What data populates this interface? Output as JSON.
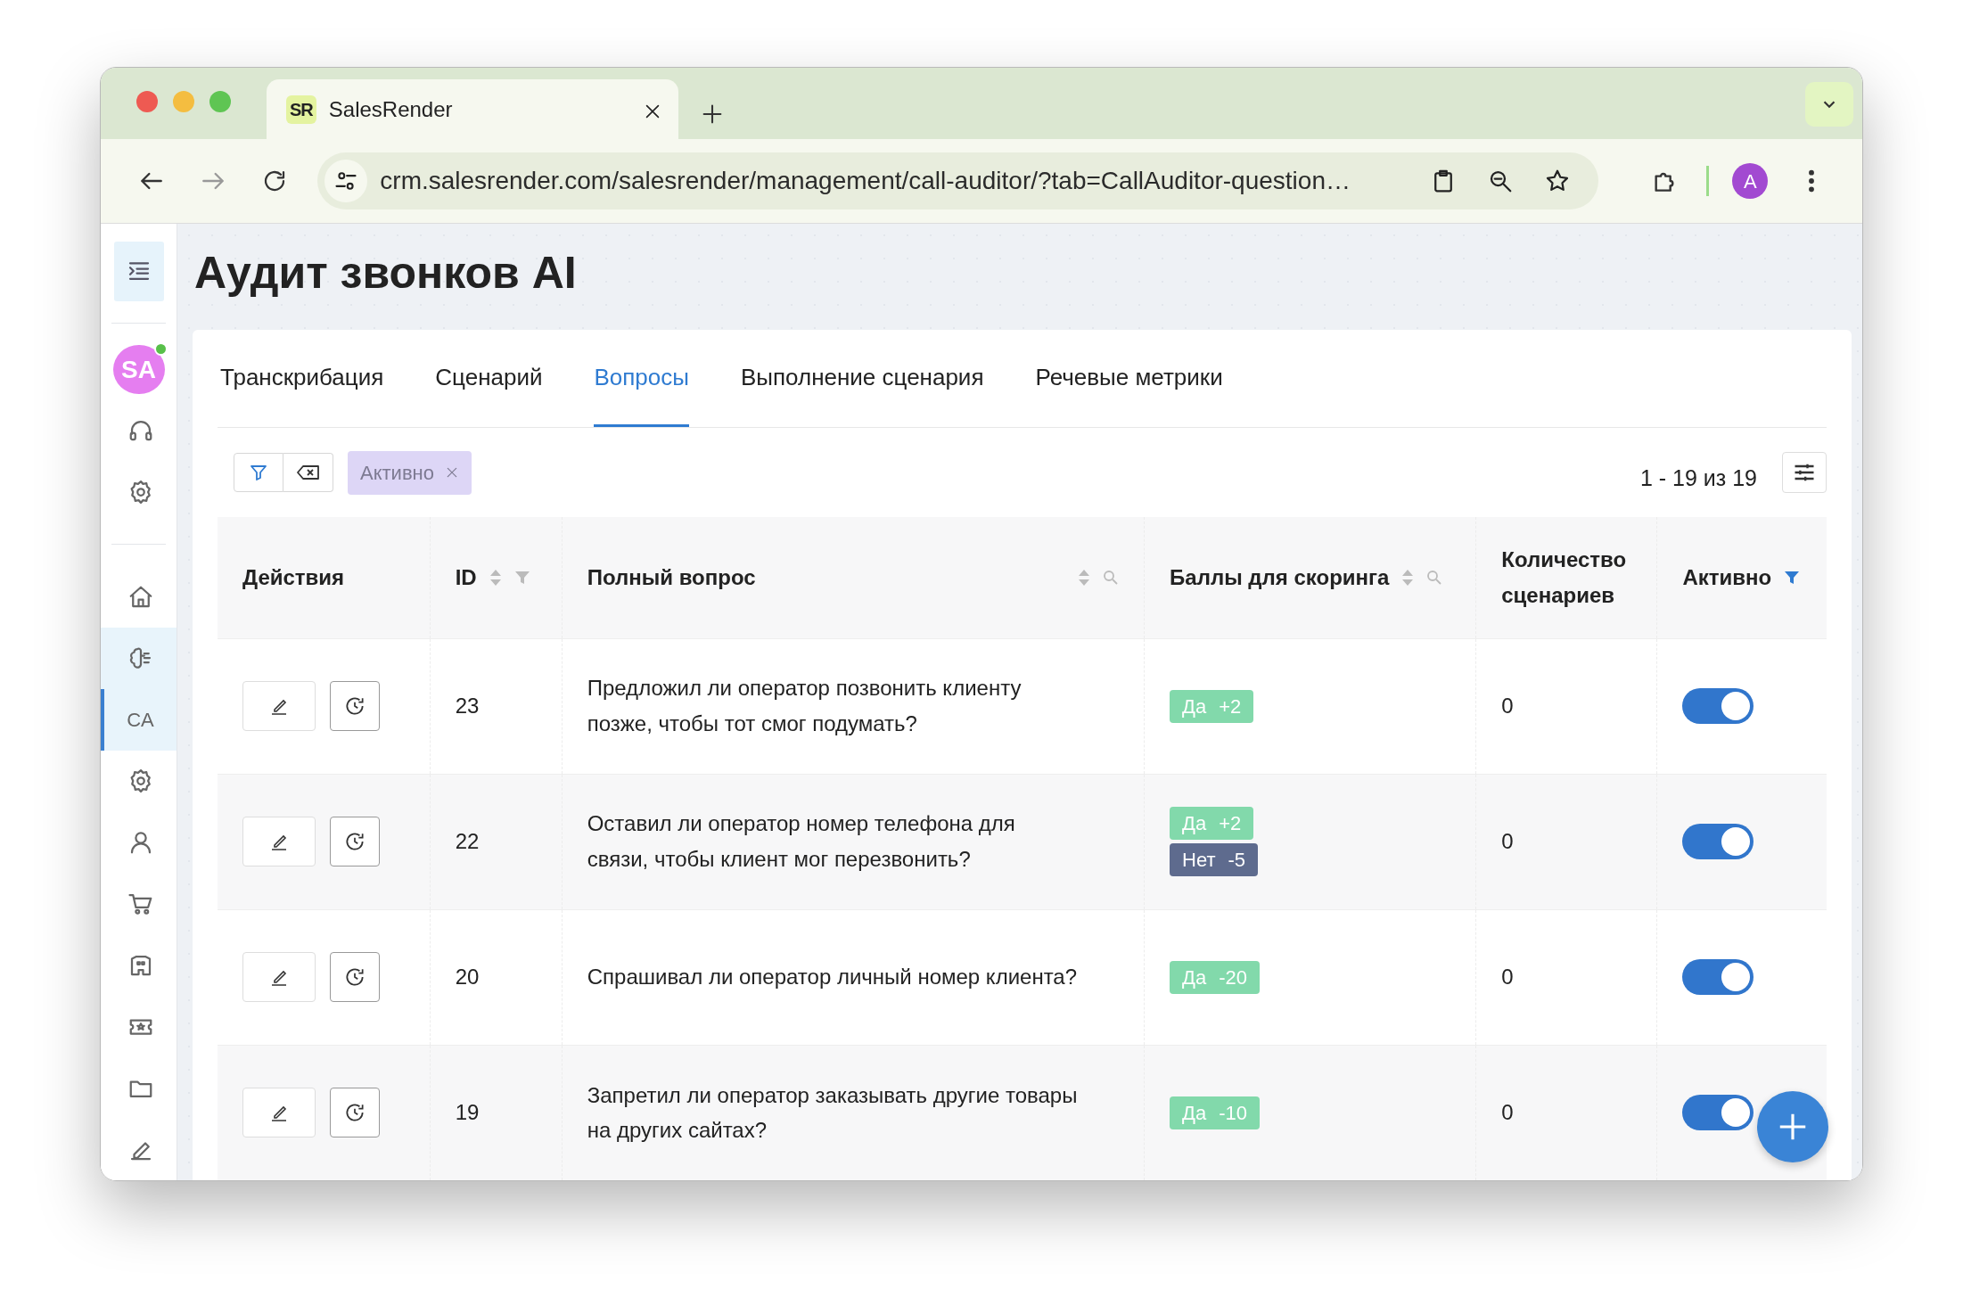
{
  "browser": {
    "tab_title": "SalesRender",
    "favicon": "SR",
    "url": "crm.salesrender.com/salesrender/management/call-auditor/?tab=CallAuditor-question…",
    "profile": "A"
  },
  "sidebar": {
    "avatar": "SA",
    "online": true,
    "top_items": [
      {
        "kind": "icon",
        "selected": false,
        "highlighted": false
      },
      {
        "kind": "icon",
        "selected": false,
        "highlighted": false
      }
    ],
    "items": [
      {
        "kind": "icon",
        "selected": false,
        "highlighted": false
      },
      {
        "kind": "icon",
        "selected": false,
        "highlighted": true
      },
      {
        "kind": "text",
        "label": "CA",
        "selected": true,
        "highlighted": true
      },
      {
        "kind": "icon",
        "selected": false,
        "highlighted": false
      },
      {
        "kind": "icon",
        "selected": false,
        "highlighted": false
      },
      {
        "kind": "icon",
        "selected": false,
        "highlighted": false
      },
      {
        "kind": "icon",
        "selected": false,
        "highlighted": false
      },
      {
        "kind": "icon",
        "selected": false,
        "highlighted": false
      },
      {
        "kind": "icon",
        "selected": false,
        "highlighted": false
      },
      {
        "kind": "icon",
        "selected": false,
        "highlighted": false
      }
    ]
  },
  "page_title": "Аудит звонков AI",
  "tabs": [
    {
      "label": "Транскрибация",
      "selected": false
    },
    {
      "label": "Сценарий",
      "selected": false
    },
    {
      "label": "Вопросы",
      "selected": true
    },
    {
      "label": "Выполнение сценария",
      "selected": false
    },
    {
      "label": "Речевые метрики",
      "selected": false
    }
  ],
  "filter_chips": [
    {
      "label": "Активно"
    }
  ],
  "pagination": "1 - 19 из 19",
  "table": {
    "columns": [
      {
        "label": "Действия"
      },
      {
        "label": "ID",
        "controls": [
          {
            "kind": "sort"
          },
          {
            "kind": "filter",
            "active": false
          }
        ]
      },
      {
        "label": "Полный вопрос",
        "controls": [
          {
            "kind": "sort"
          },
          {
            "kind": "search"
          }
        ]
      },
      {
        "label": "Баллы для скоринга",
        "controls": [
          {
            "kind": "sort"
          },
          {
            "kind": "search"
          }
        ]
      },
      {
        "label": "Количество сценариев"
      },
      {
        "label": "Активно",
        "controls": [
          {
            "kind": "filter",
            "active": true
          }
        ]
      }
    ],
    "rows": [
      {
        "id": "23",
        "question": "Предложил ли оператор позвонить клиенту позже, чтобы тот смог подумать?",
        "scores": [
          {
            "kind": "yes",
            "label": "Да",
            "value": "+2"
          }
        ],
        "scenarios": "0",
        "active": true
      },
      {
        "id": "22",
        "question": "Оставил ли оператор номер телефона для связи, чтобы клиент мог перезвонить?",
        "scores": [
          {
            "kind": "yes",
            "label": "Да",
            "value": "+2"
          },
          {
            "kind": "no",
            "label": "Нет",
            "value": "-5"
          }
        ],
        "scenarios": "0",
        "active": true
      },
      {
        "id": "20",
        "question": "Спрашивал ли оператор личный номер клиента?",
        "scores": [
          {
            "kind": "yes",
            "label": "Да",
            "value": "-20"
          }
        ],
        "scenarios": "0",
        "active": true
      },
      {
        "id": "19",
        "question": "Запретил ли оператор заказывать другие товары на других сайтах?",
        "scores": [
          {
            "kind": "yes",
            "label": "Да",
            "value": "-10"
          }
        ],
        "scenarios": "0",
        "active": true
      }
    ]
  }
}
